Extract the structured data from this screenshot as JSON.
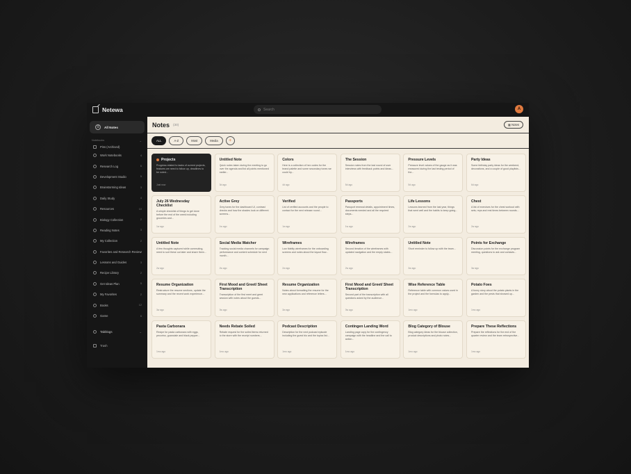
{
  "app": {
    "name": "Netewa",
    "avatar_initial": "A"
  },
  "search": {
    "placeholder": "Search"
  },
  "sidebar": {
    "new_note": "All Notes",
    "section_title": "Notebooks",
    "first_item": "Pins (Archived)",
    "items": [
      {
        "label": "Work Notebooks",
        "count": "4"
      },
      {
        "label": "Research Log",
        "count": "6"
      },
      {
        "label": "Development Studio",
        "count": "5"
      },
      {
        "label": "Brainstorming Ideas",
        "count": "3"
      },
      {
        "label": "Daily Study",
        "count": "4"
      },
      {
        "label": "Resources",
        "count": "10"
      },
      {
        "label": "Biology Collection",
        "count": "2"
      },
      {
        "label": "Reading Notes",
        "count": "3"
      },
      {
        "label": "My Collection",
        "count": "2"
      },
      {
        "label": "Favorites and Research Reviews",
        "count": ""
      },
      {
        "label": "Lessons and Guides",
        "count": "3"
      },
      {
        "label": "Recipe Library",
        "count": "2"
      },
      {
        "label": "Get Ideas Plan",
        "count": "5"
      },
      {
        "label": "My Favorites",
        "count": "2"
      },
      {
        "label": "Books",
        "count": "12"
      },
      {
        "label": "Game",
        "count": "6"
      }
    ],
    "tags": "Tabblogs",
    "trash": "Trash"
  },
  "main": {
    "title": "Notes",
    "count": "(30)",
    "sort_label": "Notes",
    "filters": [
      "ALL",
      "A-Z",
      "Most",
      "Media"
    ]
  },
  "notes": [
    {
      "title": "Projects",
      "body": "Progress related to tasks of current projects, features we need to follow up, deadlines to be noted...",
      "date": "Just now",
      "dark": true,
      "pinned": true
    },
    {
      "title": "Untitled Note",
      "body": "Quick notes taken during the meeting to go over the agenda and list all points mentioned earlier...",
      "date": "3d ago"
    },
    {
      "title": "Colors",
      "body": "Here is a collection of hex codes for the brand palette and some secondary tones we could try...",
      "date": "4d ago"
    },
    {
      "title": "The Session",
      "body": "Session notes from the last round of user interviews with feedback points and ideas...",
      "date": "5d ago"
    },
    {
      "title": "Pressure Levels",
      "body": "Pressure level values of the gauge as it was measured during the last testing period of the...",
      "date": "5d ago"
    },
    {
      "title": "Party Ideas",
      "body": "Some birthday party ideas for the weekend, decorations, and a couple of good playlists...",
      "date": "6d ago"
    },
    {
      "title": "July 26 Wednesday Checklist",
      "body": "A simple checklist of things to get done before the end of the week including groceries and...",
      "date": "1w ago"
    },
    {
      "title": "Active Grey",
      "body": "Grey tones for the dashboard UI, contrast checks and how the shades look on different screens...",
      "date": "1w ago"
    },
    {
      "title": "Verified",
      "body": "List of verified accounts and the people to contact for the next release round...",
      "date": "1w ago"
    },
    {
      "title": "Passports",
      "body": "Passport renewal details, appointment times, documents needed and all the required steps...",
      "date": "1w ago"
    },
    {
      "title": "Life Lessons",
      "body": "Lessons learned from the last year, things that went well and the habits to keep going...",
      "date": "2w ago"
    },
    {
      "title": "Chest",
      "body": "A list of exercises for the chest workout with sets, reps and rest times between rounds...",
      "date": "2w ago"
    },
    {
      "title": "Untitled Note",
      "body": "A few thoughts captured while commuting, need to sort these out later and share them...",
      "date": "2w ago"
    },
    {
      "title": "Social Media Watcher",
      "body": "Tracking social media channels for campaign performance and content schedule for next month...",
      "date": "2w ago"
    },
    {
      "title": "Wireframes",
      "body": "Low fidelity wireframes for the onboarding screens and notes about the layout flow...",
      "date": "2w ago"
    },
    {
      "title": "Wireframes",
      "body": "Second iteration of the wireframes with updated navigation and the empty states...",
      "date": "2w ago"
    },
    {
      "title": "Untitled Note",
      "body": "Short reminder to follow up with the team...",
      "date": "3w ago"
    },
    {
      "title": "Points for Exchange",
      "body": "Discussion points for the exchange program meeting, questions to ask and contacts...",
      "date": "3w ago"
    },
    {
      "title": "Resume Organization",
      "body": "Restructure the resume sections, update the summary and the recent work experience...",
      "date": "3w ago"
    },
    {
      "title": "First Mood and Greet/ Sheet Transcription",
      "body": "Transcription of the first meet and greet session with notes about the guests...",
      "date": "3w ago"
    },
    {
      "title": "Resume Organization",
      "body": "Notes about formatting the resume for the new applications and reference letters...",
      "date": "3w ago"
    },
    {
      "title": "First Mood and Greet/ Sheet Transcription",
      "body": "Second part of the transcription with all questions asked by the audience...",
      "date": "3w ago"
    },
    {
      "title": "Wise Reference Table",
      "body": "Reference table with common values used in the project and the formulas to apply...",
      "date": "1mo ago"
    },
    {
      "title": "Potato Foes",
      "body": "A funny story about the potato plants in the garden and the pests that showed up...",
      "date": "1mo ago"
    },
    {
      "title": "Pasta Carbonara",
      "body": "Recipe for pasta carbonara with eggs, pecorino, guanciale and black pepper...",
      "date": "1mo ago"
    },
    {
      "title": "Needs Rebate Soiled",
      "body": "Rebate request for the soiled items returned to the store with the receipt numbers...",
      "date": "1mo ago"
    },
    {
      "title": "Podcast Description",
      "body": "Description for the next podcast episode including the guest bio and the topics list...",
      "date": "1mo ago"
    },
    {
      "title": "Contingen Landing Word",
      "body": "Landing page copy for the contingency campaign with the headline and the call to action...",
      "date": "1mo ago"
    },
    {
      "title": "Blog Category of Blouse",
      "body": "Blog category ideas for the blouse collection, product descriptions and photo notes...",
      "date": "1mo ago"
    },
    {
      "title": "Prepare These Reflections",
      "body": "Prepare the reflections for the end of the quarter review and the team retrospective...",
      "date": "1mo ago"
    }
  ],
  "colors": {
    "accent": "#e07a3f",
    "cream": "#f3ece0",
    "dark": "#161616"
  }
}
